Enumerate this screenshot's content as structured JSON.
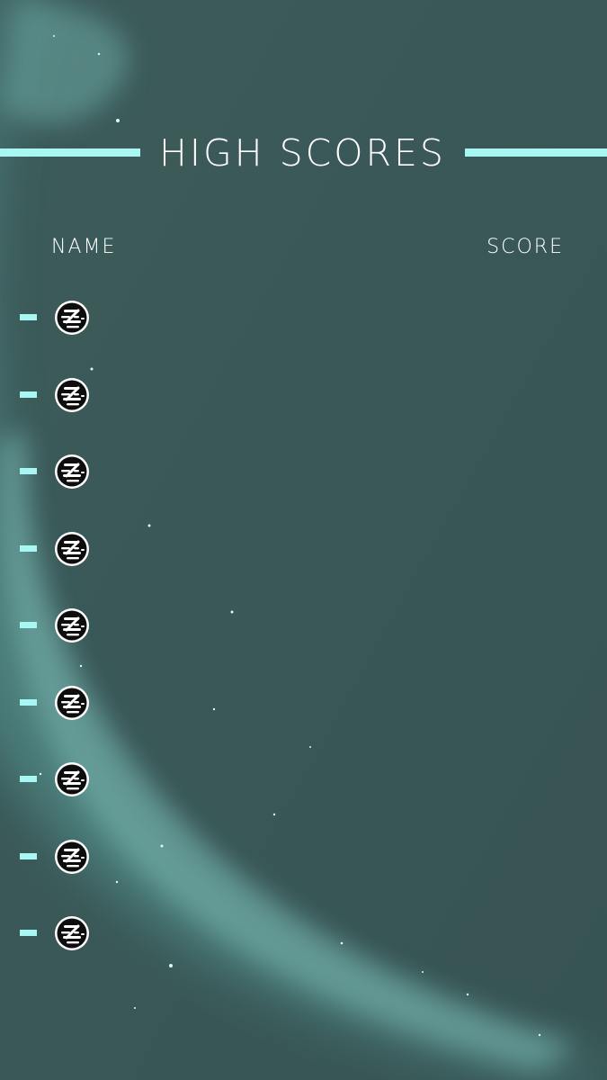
{
  "screen": {
    "title": "HIGH SCORES",
    "columns": {
      "name": "NAME",
      "score": "SCORE"
    },
    "colors": {
      "accent": "#a8f7f2",
      "background": "#3a5656",
      "nebula": "#5fa8a3",
      "text": "#ffffff"
    }
  },
  "rows": [
    {
      "rank_marker": "dash",
      "avatar": "game-logo-icon",
      "name": "",
      "score": ""
    },
    {
      "rank_marker": "dash",
      "avatar": "game-logo-icon",
      "name": "",
      "score": ""
    },
    {
      "rank_marker": "dash",
      "avatar": "game-logo-icon",
      "name": "",
      "score": ""
    },
    {
      "rank_marker": "dash",
      "avatar": "game-logo-icon",
      "name": "",
      "score": ""
    },
    {
      "rank_marker": "dash",
      "avatar": "game-logo-icon",
      "name": "",
      "score": ""
    },
    {
      "rank_marker": "dash",
      "avatar": "game-logo-icon",
      "name": "",
      "score": ""
    },
    {
      "rank_marker": "dash",
      "avatar": "game-logo-icon",
      "name": "",
      "score": ""
    },
    {
      "rank_marker": "dash",
      "avatar": "game-logo-icon",
      "name": "",
      "score": ""
    },
    {
      "rank_marker": "dash",
      "avatar": "game-logo-icon",
      "name": "",
      "score": ""
    }
  ]
}
